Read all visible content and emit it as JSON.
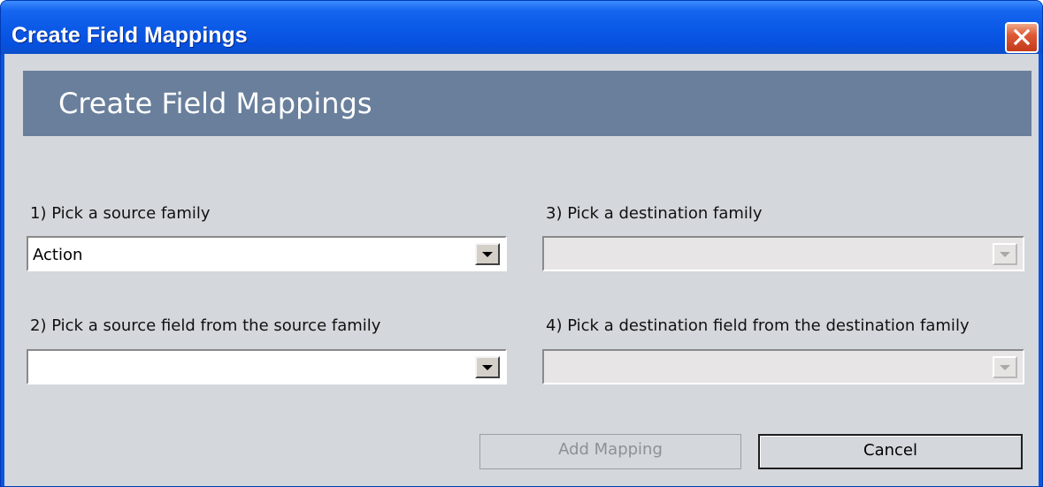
{
  "window": {
    "title": "Create Field Mappings"
  },
  "header": {
    "title": "Create Field Mappings"
  },
  "form": {
    "source_family": {
      "label": "1) Pick a source family",
      "value": "Action"
    },
    "source_field": {
      "label": "2) Pick a source field from the source family",
      "value": ""
    },
    "destination_family": {
      "label": "3) Pick a destination family",
      "value": "",
      "enabled": false
    },
    "destination_field": {
      "label": "4) Pick a destination field from the destination family",
      "value": "",
      "enabled": false
    }
  },
  "buttons": {
    "add_mapping": {
      "label": "Add Mapping",
      "enabled": false
    },
    "cancel": {
      "label": "Cancel",
      "enabled": true
    }
  },
  "icons": {
    "close": "close-icon",
    "dropdown": "chevron-down-icon"
  },
  "colors": {
    "titlebar": "#0a58e6",
    "banner": "#697f9c",
    "client_background": "#d4d7db",
    "close_button": "#dd5a35"
  }
}
